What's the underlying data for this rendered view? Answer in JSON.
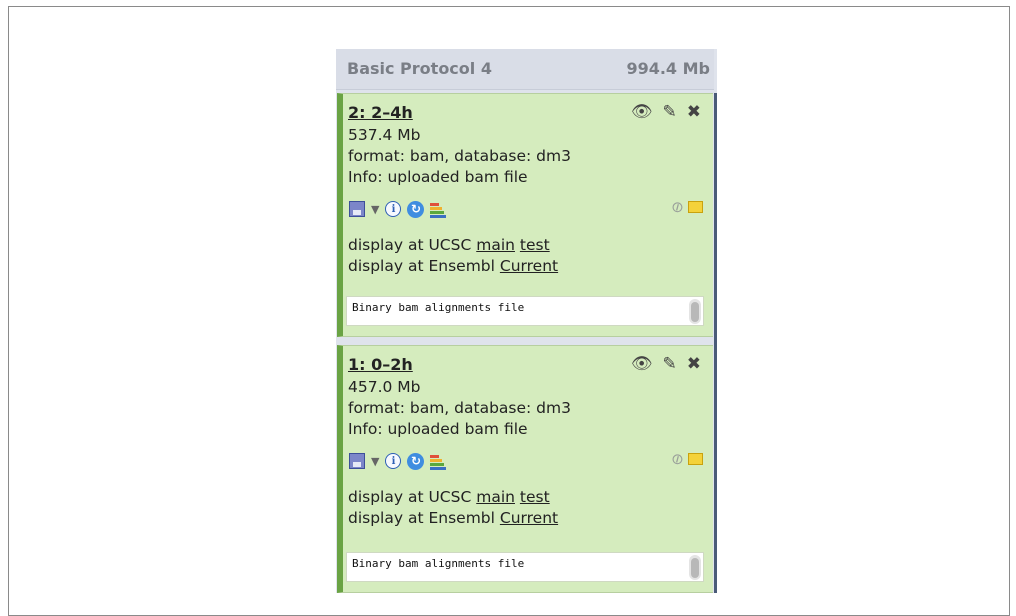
{
  "history": {
    "title": "Basic Protocol 4",
    "size": "994.4 Mb"
  },
  "datasets": [
    {
      "title": "2: 2–4h",
      "size": "537.4 Mb",
      "format": "format: bam, database: dm3",
      "info": "Info: uploaded bam file",
      "ucsc_prefix": "display at UCSC",
      "ucsc_main": "main",
      "ucsc_test": "test",
      "ensembl_prefix": "display at Ensembl",
      "ensembl_current": "Current",
      "peek": "Binary bam alignments file"
    },
    {
      "title": "1: 0–2h",
      "size": "457.0 Mb",
      "format": "format: bam, database: dm3",
      "info": "Info: uploaded bam file",
      "ucsc_prefix": "display at UCSC",
      "ucsc_main": "main",
      "ucsc_test": "test",
      "ensembl_prefix": "display at Ensembl",
      "ensembl_current": "Current",
      "peek": "Binary bam alignments file"
    }
  ],
  "icons": {
    "view": "eye-icon",
    "edit": "pencil-icon",
    "delete": "delete-icon",
    "save": "save-icon",
    "info": "info-icon",
    "rerun": "rerun-icon",
    "visualize": "visualize-icon",
    "tags": "tag-icon",
    "annotation": "annotation-icon"
  },
  "colors": {
    "dataset_bg": "#d5ecbe",
    "dataset_border": "#6aa344",
    "header_bg": "#d9dde7"
  }
}
